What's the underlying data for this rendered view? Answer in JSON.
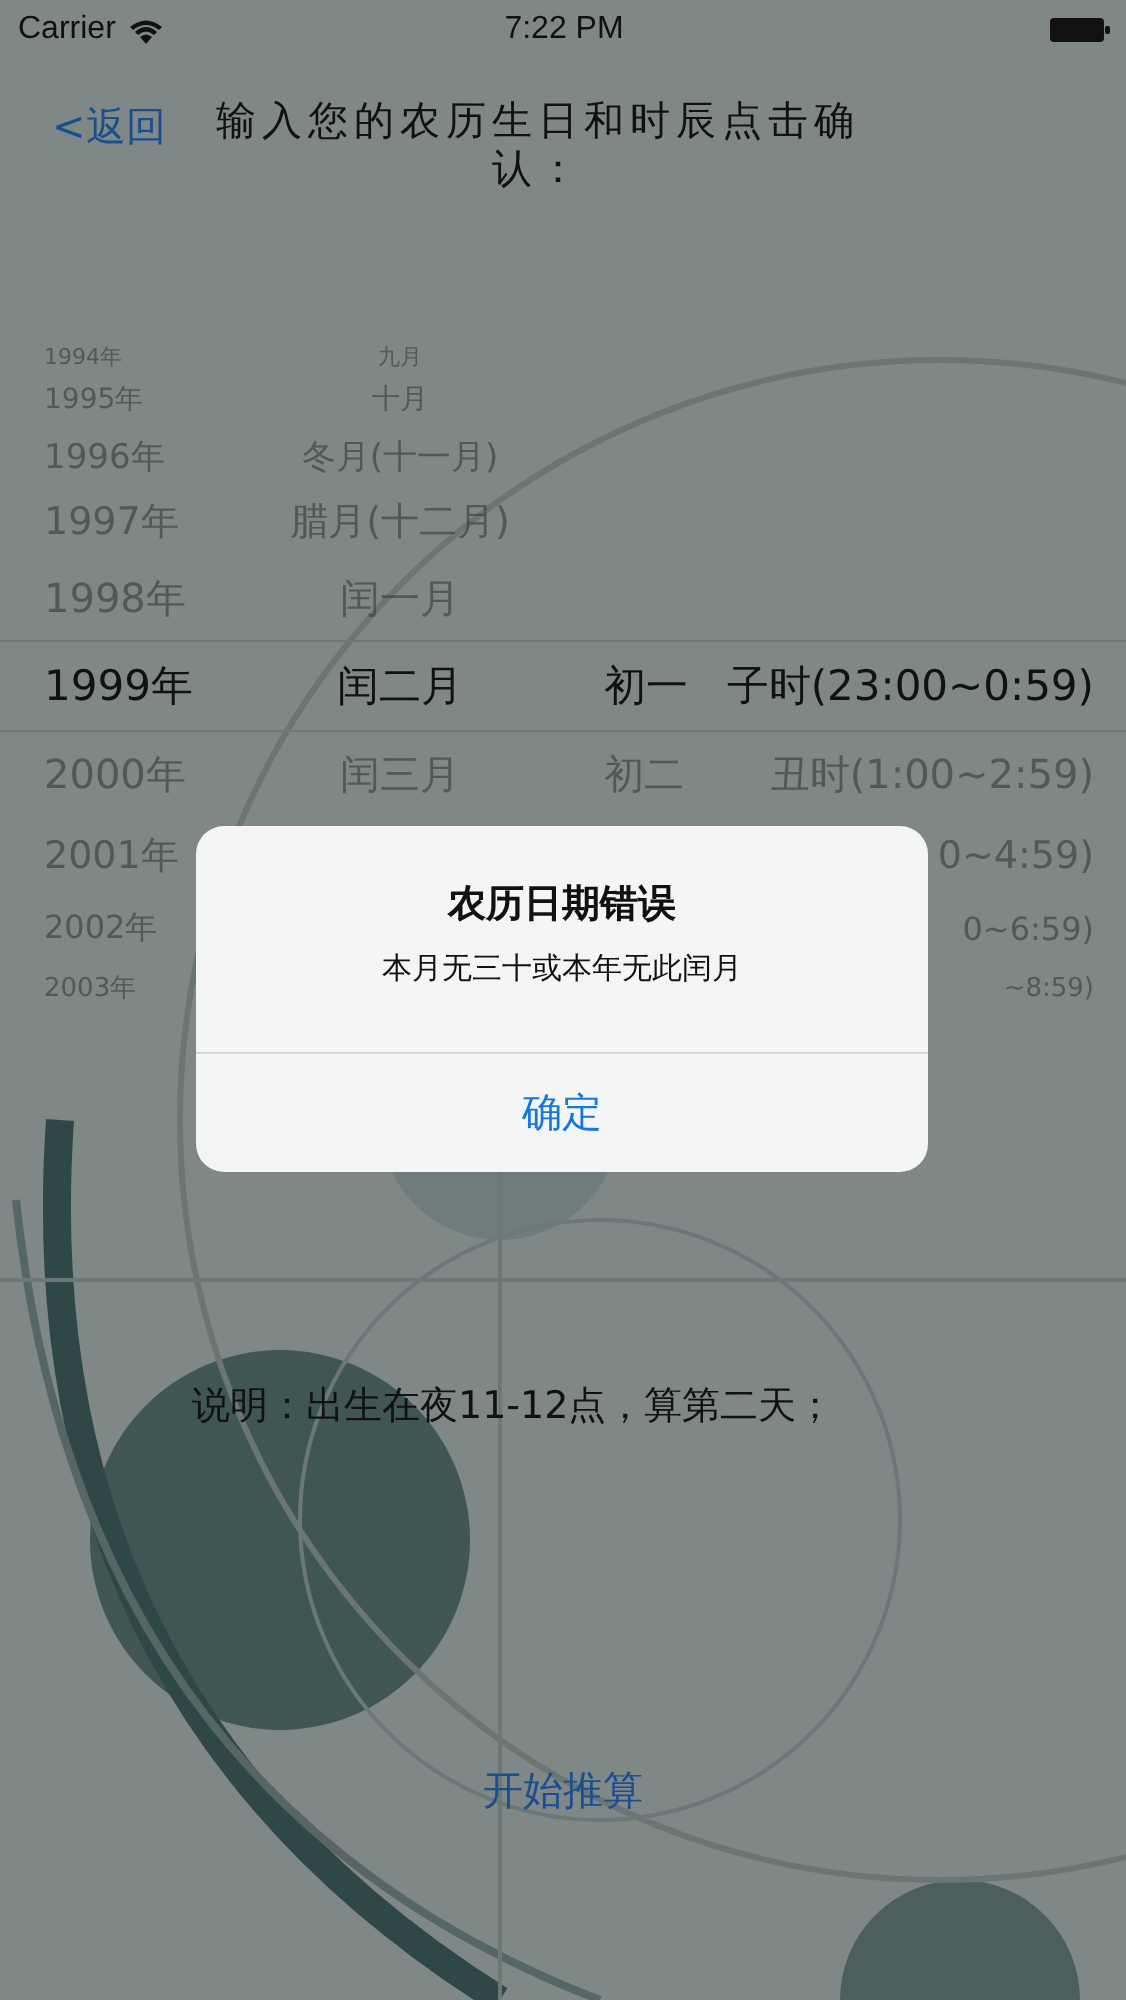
{
  "status_bar": {
    "carrier": "Carrier",
    "time": "7:22 PM"
  },
  "nav": {
    "back": "<返回",
    "title": "输入您的农历生日和时辰点击确认："
  },
  "picker": [
    {
      "year": "1994年",
      "month": "九月",
      "selected": false
    },
    {
      "year": "1995年",
      "month": "十月",
      "selected": false
    },
    {
      "year": "1996年",
      "month": "冬月(十一月)",
      "selected": false
    },
    {
      "year": "1997年",
      "month": "腊月(十二月)",
      "selected": false
    },
    {
      "year": "1998年",
      "month": "闰一月",
      "selected": false
    },
    {
      "year": "1999年",
      "month": "闰二月",
      "day": "初一",
      "hour": "子时(23:00~0:59)",
      "selected": true
    },
    {
      "year": "2000年",
      "month": "闰三月",
      "day": "初二",
      "hour": "丑时(1:00~2:59)",
      "selected": false
    },
    {
      "year": "2001年",
      "hour": "0~4:59)",
      "selected": false
    },
    {
      "year": "2002年",
      "hour": "0~6:59)",
      "selected": false
    },
    {
      "year": "2003年",
      "hour": "~8:59)",
      "selected": false
    }
  ],
  "alert": {
    "title": "农历日期错误",
    "message": "本月无三十或本年无此闰月",
    "button": "确定"
  },
  "note": "说明：出生在夜11-12点，算第二天；",
  "action": "开始推算"
}
